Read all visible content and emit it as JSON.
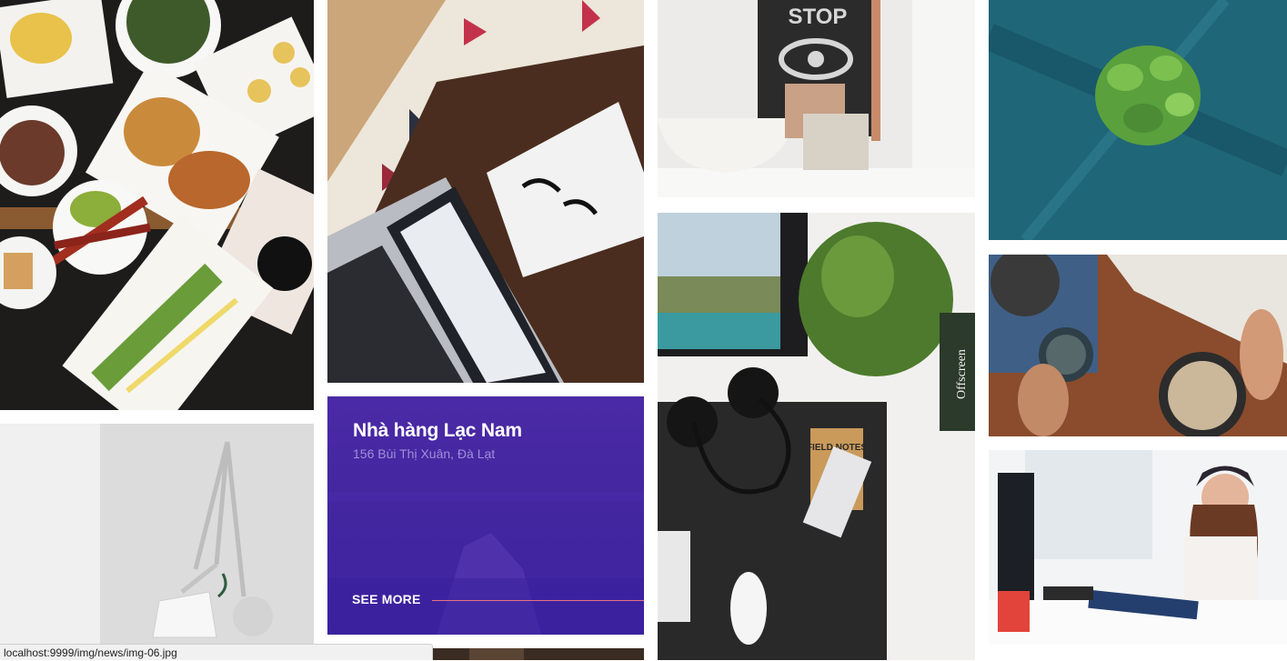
{
  "feature_card": {
    "title": "Nhà hàng Lạc Nam",
    "address": "156 Bùi Thị Xuân, Đà Lạt",
    "more_label": "SEE MORE"
  },
  "status_bar": {
    "url": "localhost:9999/img/news/img-06.jpg"
  },
  "photo_text": {
    "stop_sign": "STOP",
    "notebook": "FIELD NOTES",
    "book_spine": "Offscreen"
  },
  "colors": {
    "feature_bg": "#4326a0",
    "feature_subtitle": "#9f8fd8",
    "more_underline": "#e8708a"
  }
}
